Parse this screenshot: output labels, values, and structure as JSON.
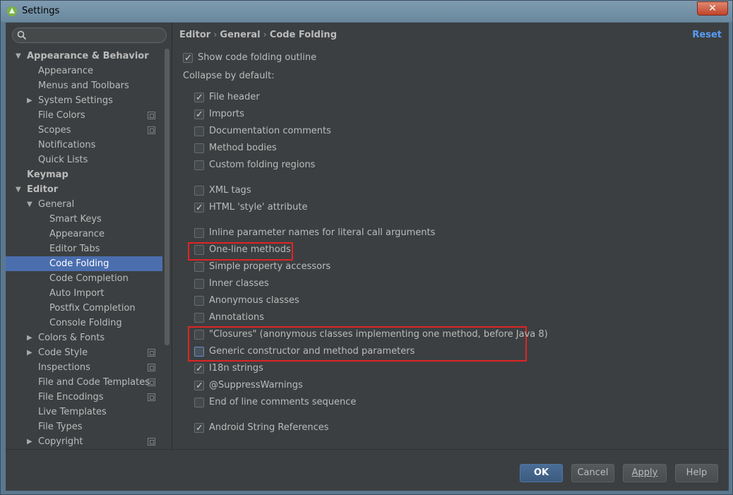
{
  "window": {
    "title": "Settings",
    "close_label": "✕"
  },
  "search": {
    "placeholder": "",
    "value": ""
  },
  "sidebar": {
    "items": [
      {
        "label": "Appearance & Behavior",
        "bold": true,
        "level": 0,
        "arrow": "▼"
      },
      {
        "label": "Appearance",
        "level": 1
      },
      {
        "label": "Menus and Toolbars",
        "level": 1
      },
      {
        "label": "System Settings",
        "level": 1,
        "arrow": "▶"
      },
      {
        "label": "File Colors",
        "level": 1,
        "proj": true
      },
      {
        "label": "Scopes",
        "level": 1,
        "proj": true
      },
      {
        "label": "Notifications",
        "level": 1
      },
      {
        "label": "Quick Lists",
        "level": 1
      },
      {
        "label": "Keymap",
        "bold": true,
        "level": 0
      },
      {
        "label": "Editor",
        "bold": true,
        "level": 0,
        "arrow": "▼"
      },
      {
        "label": "General",
        "level": 1,
        "arrow": "▼"
      },
      {
        "label": "Smart Keys",
        "level": 2
      },
      {
        "label": "Appearance",
        "level": 2
      },
      {
        "label": "Editor Tabs",
        "level": 2
      },
      {
        "label": "Code Folding",
        "level": 2,
        "selected": true
      },
      {
        "label": "Code Completion",
        "level": 2
      },
      {
        "label": "Auto Import",
        "level": 2
      },
      {
        "label": "Postfix Completion",
        "level": 2
      },
      {
        "label": "Console Folding",
        "level": 2
      },
      {
        "label": "Colors & Fonts",
        "level": 1,
        "arrow": "▶"
      },
      {
        "label": "Code Style",
        "level": 1,
        "arrow": "▶",
        "proj": true
      },
      {
        "label": "Inspections",
        "level": 1,
        "proj": true
      },
      {
        "label": "File and Code Templates",
        "level": 1,
        "proj": true
      },
      {
        "label": "File Encodings",
        "level": 1,
        "proj": true
      },
      {
        "label": "Live Templates",
        "level": 1
      },
      {
        "label": "File Types",
        "level": 1
      },
      {
        "label": "Copyright",
        "level": 1,
        "arrow": "▶",
        "proj": true
      }
    ]
  },
  "breadcrumb": {
    "part1": "Editor",
    "part2": "General",
    "part3": "Code Folding",
    "sep": "›"
  },
  "reset_label": "Reset",
  "show_outline": {
    "label": "Show code folding outline",
    "checked": true
  },
  "collapse_label": "Collapse by default:",
  "options": [
    {
      "label": "File header",
      "checked": true
    },
    {
      "label": "Imports",
      "checked": true
    },
    {
      "label": "Documentation comments",
      "checked": false
    },
    {
      "label": "Method bodies",
      "checked": false
    },
    {
      "label": "Custom folding regions",
      "checked": false
    },
    {
      "label": "XML tags",
      "checked": false
    },
    {
      "label": "HTML 'style' attribute",
      "checked": true
    },
    {
      "label": "Inline parameter names for literal call arguments",
      "checked": false
    },
    {
      "label": "One-line methods",
      "checked": false
    },
    {
      "label": "Simple property accessors",
      "checked": false
    },
    {
      "label": "Inner classes",
      "checked": false
    },
    {
      "label": "Anonymous classes",
      "checked": false
    },
    {
      "label": "Annotations",
      "checked": false
    },
    {
      "label": "\"Closures\" (anonymous classes implementing one method, before Java 8)",
      "checked": false
    },
    {
      "label": "Generic constructor and method parameters",
      "checked": false,
      "focused": true
    },
    {
      "label": "I18n strings",
      "checked": true
    },
    {
      "label": "@SuppressWarnings",
      "checked": true
    },
    {
      "label": "End of line comments sequence",
      "checked": false
    },
    {
      "label": "Android String References",
      "checked": true
    }
  ],
  "buttons": {
    "ok": "OK",
    "cancel": "Cancel",
    "apply": "Apply",
    "help": "Help"
  },
  "colors": {
    "selection": "#4b6eaf",
    "link": "#589df6",
    "highlight_box": "#e02424",
    "background": "#3c3f41"
  }
}
